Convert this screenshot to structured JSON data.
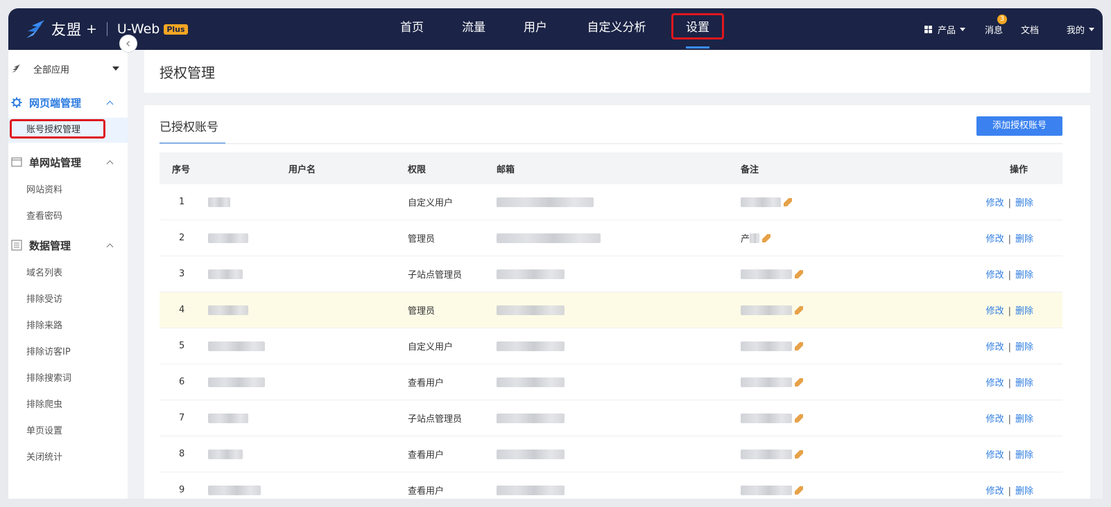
{
  "brand": {
    "name": "友盟",
    "plus": "+",
    "product": "U-Web",
    "badge": "Plus"
  },
  "nav": {
    "items": [
      {
        "label": "首页",
        "active": false
      },
      {
        "label": "流量",
        "active": false
      },
      {
        "label": "用户",
        "active": false
      },
      {
        "label": "自定义分析",
        "active": false
      },
      {
        "label": "设置",
        "active": true
      }
    ],
    "right": {
      "product_label": "产品",
      "messages_label": "消息",
      "messages_count": "3",
      "docs_label": "文档",
      "mine_label": "我的"
    }
  },
  "sidebar": {
    "app_select": "全部应用",
    "groups": [
      {
        "title": "网页端管理",
        "icon": "gear-icon",
        "active": true,
        "items": [
          {
            "label": "账号授权管理",
            "active": true
          }
        ]
      },
      {
        "title": "单网站管理",
        "icon": "window-icon",
        "active": false,
        "items": [
          {
            "label": "网站资料"
          },
          {
            "label": "查看密码"
          }
        ]
      },
      {
        "title": "数据管理",
        "icon": "list-icon",
        "active": false,
        "items": [
          {
            "label": "域名列表"
          },
          {
            "label": "排除受访"
          },
          {
            "label": "排除来路"
          },
          {
            "label": "排除访客IP"
          },
          {
            "label": "排除搜索词"
          },
          {
            "label": "排除爬虫"
          },
          {
            "label": "单页设置"
          },
          {
            "label": "关闭统计"
          }
        ]
      }
    ]
  },
  "page": {
    "title": "授权管理"
  },
  "card": {
    "tab_label": "已授权账号",
    "add_button": "添加授权账号",
    "columns": {
      "idx": "序号",
      "user": "用户名",
      "perm": "权限",
      "mail": "邮箱",
      "note": "备注",
      "op": "操作"
    },
    "rows": [
      {
        "idx": "1",
        "perm": "自定义用户",
        "highlight": false
      },
      {
        "idx": "2",
        "perm": "管理员",
        "highlight": false,
        "note_prefix": "产"
      },
      {
        "idx": "3",
        "perm": "子站点管理员",
        "highlight": false
      },
      {
        "idx": "4",
        "perm": "管理员",
        "highlight": true
      },
      {
        "idx": "5",
        "perm": "自定义用户",
        "highlight": false
      },
      {
        "idx": "6",
        "perm": "查看用户",
        "highlight": false
      },
      {
        "idx": "7",
        "perm": "子站点管理员",
        "highlight": false
      },
      {
        "idx": "8",
        "perm": "查看用户",
        "highlight": false
      },
      {
        "idx": "9",
        "perm": "查看用户",
        "highlight": false
      }
    ],
    "op_edit": "修改",
    "op_sep": "|",
    "op_delete": "删除"
  },
  "colors": {
    "nav_bg": "#1b2446",
    "accent": "#2f7de1",
    "highlight_box": "#e0161e",
    "row_highlight": "#fdfbe6"
  }
}
